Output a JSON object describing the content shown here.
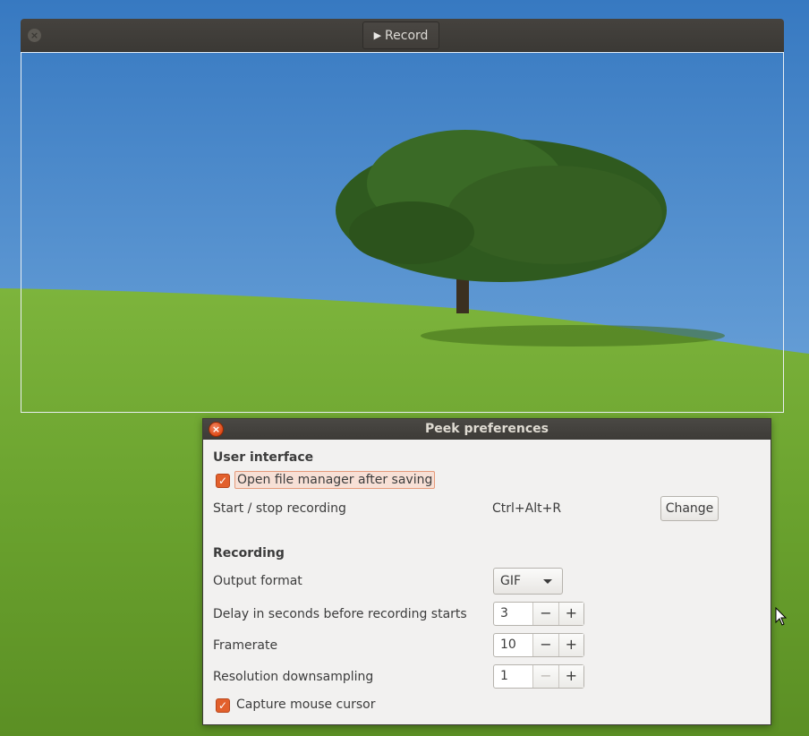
{
  "peek_window": {
    "record_label": "Record",
    "record_icon": "play-icon"
  },
  "preferences": {
    "title": "Peek preferences",
    "user_interface": {
      "heading": "User interface",
      "open_file_manager": {
        "label": "Open file manager after saving",
        "checked": true
      },
      "start_stop": {
        "label": "Start / stop recording",
        "shortcut": "Ctrl+Alt+R",
        "change_label": "Change"
      }
    },
    "recording": {
      "heading": "Recording",
      "output_format": {
        "label": "Output format",
        "value": "GIF"
      },
      "delay": {
        "label": "Delay in seconds before recording starts",
        "value": "3"
      },
      "framerate": {
        "label": "Framerate",
        "value": "10"
      },
      "downsampling": {
        "label": "Resolution downsampling",
        "value": "1"
      },
      "capture_cursor": {
        "label": "Capture mouse cursor",
        "checked": true
      }
    },
    "spin": {
      "minus": "−",
      "plus": "+"
    }
  },
  "colors": {
    "accent": "#e2602c",
    "titlebar": "#3d3b37",
    "dialog_bg": "#f2f1f0"
  }
}
